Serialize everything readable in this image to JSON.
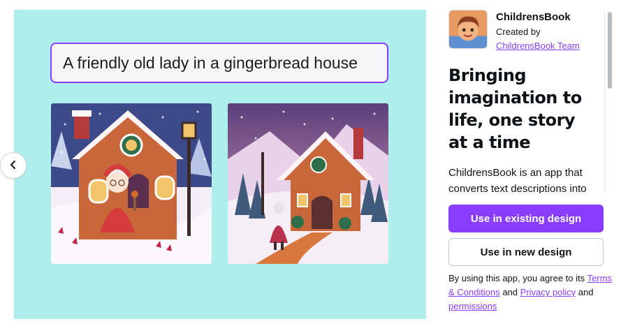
{
  "preview": {
    "background": "#aeeeed",
    "prompt_text": "A friendly old lady in a gingerbread house",
    "images": [
      {
        "name": "gingerbread-house-lady-front"
      },
      {
        "name": "gingerbread-house-lady-back"
      }
    ],
    "prev_icon": "chevron-left-icon"
  },
  "app": {
    "name": "ChildrensBook",
    "created_by_label": "Created by",
    "creator": "ChildrensBook Team",
    "headline": "Bringing imagination to life, one story at a time",
    "description": "ChildrensBook is an app that converts text descriptions into",
    "primary_button": "Use in existing design",
    "secondary_button": "Use in new design",
    "terms": {
      "prefix": "By using this app, you agree to its",
      "terms_link": "Terms & Conditions",
      "and1": "and",
      "privacy_link": "Privacy policy",
      "and2": "and",
      "permissions_link": "permissions"
    }
  },
  "colors": {
    "accent": "#8b3dff",
    "preview_bg": "#aeeeed"
  }
}
